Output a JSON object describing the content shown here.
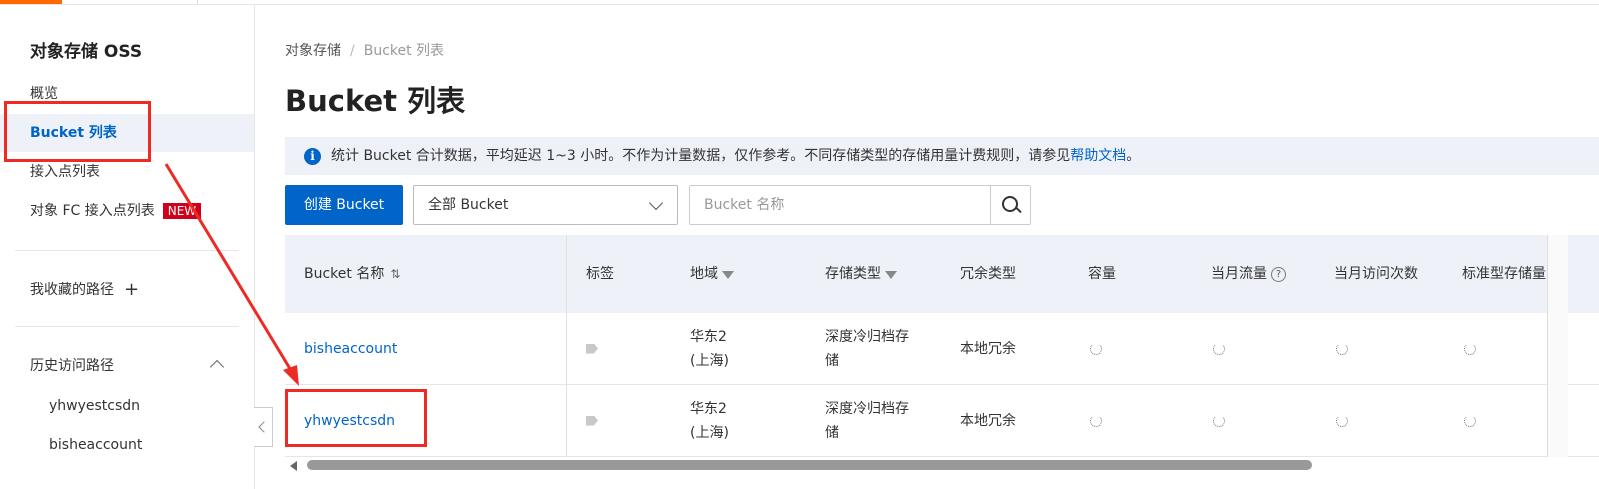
{
  "sidebar": {
    "title": "对象存储 OSS",
    "items": [
      {
        "label": "概览"
      },
      {
        "label": "Bucket 列表"
      },
      {
        "label": "接入点列表"
      },
      {
        "label": "对象 FC 接入点列表",
        "badge": "NEW"
      }
    ],
    "favorites_label": "我收藏的路径",
    "history_label": "历史访问路径",
    "history_items": [
      "yhwyestcsdn",
      "bisheaccount"
    ]
  },
  "breadcrumb": {
    "root": "对象存储",
    "separator": "/",
    "current": "Bucket 列表"
  },
  "page_title": "Bucket 列表",
  "info": {
    "text": "统计 Bucket 合计数据，平均延迟 1~3 小时。不作为计量数据，仅作参考。不同存储类型的存储用量计费规则，请参见",
    "link": "帮助文档",
    "suffix": "。"
  },
  "toolbar": {
    "create_label": "创建 Bucket",
    "filter_value": "全部 Bucket",
    "search_placeholder": "Bucket 名称"
  },
  "table": {
    "headers": [
      "Bucket 名称",
      "标签",
      "地域",
      "存储类型",
      "冗余类型",
      "容量",
      "当月流量",
      "当月访问次数",
      "标准型存储量"
    ],
    "rows": [
      {
        "name": "bisheaccount",
        "region_line1": "华东2",
        "region_line2": "(上海)",
        "storage_line1": "深度冷归档存",
        "storage_line2": "储",
        "redundancy": "本地冗余"
      },
      {
        "name": "yhwyestcsdn",
        "region_line1": "华东2",
        "region_line2": "(上海)",
        "storage_line1": "深度冷归档存",
        "storage_line2": "储",
        "redundancy": "本地冗余"
      }
    ]
  },
  "colors": {
    "accent": "#0064c8",
    "annotation": "#ee2a24",
    "brand": "#ff6a00"
  }
}
